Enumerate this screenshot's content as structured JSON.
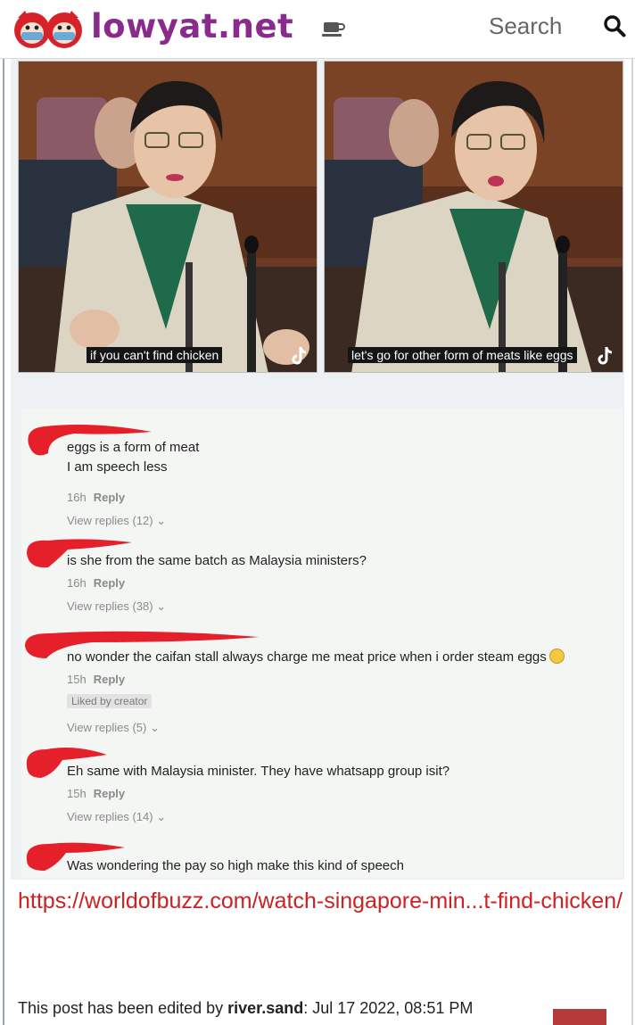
{
  "header": {
    "logo_text": "lowyat.net",
    "search_label": "Search",
    "icons": [
      "logo-mascot-icon",
      "coffee-cup-icon",
      "search-icon"
    ]
  },
  "screenshot": {
    "captions": [
      "if you can't find chicken",
      "let's go for other form of meats like eggs"
    ],
    "comments": [
      {
        "text": [
          "eggs is a form of meat",
          "I am speech less"
        ],
        "time": "16h",
        "reply": "Reply",
        "replies": "View replies (12)"
      },
      {
        "text": [
          "is she from the same batch as Malaysia ministers?"
        ],
        "time": "16h",
        "reply": "Reply",
        "replies": "View replies (38)"
      },
      {
        "text": [
          "no wonder the caifan stall always charge me meat price when i order steam eggs"
        ],
        "time": "15h",
        "reply": "Reply",
        "badge": "Liked by creator",
        "replies": "View replies (5)"
      },
      {
        "text": [
          "Eh same with Malaysia minister. They have whatsapp group isit?"
        ],
        "time": "15h",
        "reply": "Reply",
        "replies": "View replies (14)"
      },
      {
        "text": [
          "Was wondering the pay so high make this kind of speech"
        ]
      }
    ]
  },
  "post": {
    "link": "https://worldofbuzz.com/watch-singapore-min...t-find-chicken/",
    "edited_prefix": "This post has been edited by ",
    "edited_user": "river.sand",
    "edited_suffix": ": Jul 17 2022, 08:51 PM"
  },
  "colors": {
    "brand_purple": "#8a2a8c",
    "link_red": "#cc2222",
    "scribble_red": "#e5202a"
  }
}
